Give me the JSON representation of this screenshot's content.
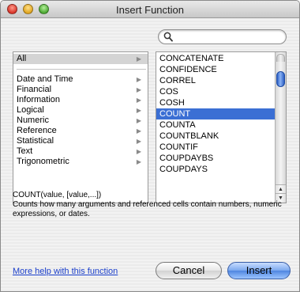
{
  "window": {
    "title": "Insert Function"
  },
  "search": {
    "value": "",
    "placeholder": ""
  },
  "categories": [
    {
      "label": "All",
      "selected": true
    },
    {
      "label": "Date and Time"
    },
    {
      "label": "Financial"
    },
    {
      "label": "Information"
    },
    {
      "label": "Logical"
    },
    {
      "label": "Numeric"
    },
    {
      "label": "Reference"
    },
    {
      "label": "Statistical"
    },
    {
      "label": "Text"
    },
    {
      "label": "Trigonometric"
    }
  ],
  "functions": [
    "CONCATENATE",
    "CONFIDENCE",
    "CORREL",
    "COS",
    "COSH",
    "COUNT",
    "COUNTA",
    "COUNTBLANK",
    "COUNTIF",
    "COUPDAYBS",
    "COUPDAYS"
  ],
  "selected_function": "COUNT",
  "syntax": "COUNT(value, [value,...])",
  "description": "Counts how many arguments and referenced cells contain numbers, numeric expressions, or dates.",
  "help_link": "More help with this function",
  "buttons": {
    "cancel": "Cancel",
    "insert": "Insert"
  },
  "colors": {
    "selection": "#3b6fd4",
    "link": "#1b3fcb",
    "category_selection": "#d4d4d4"
  }
}
